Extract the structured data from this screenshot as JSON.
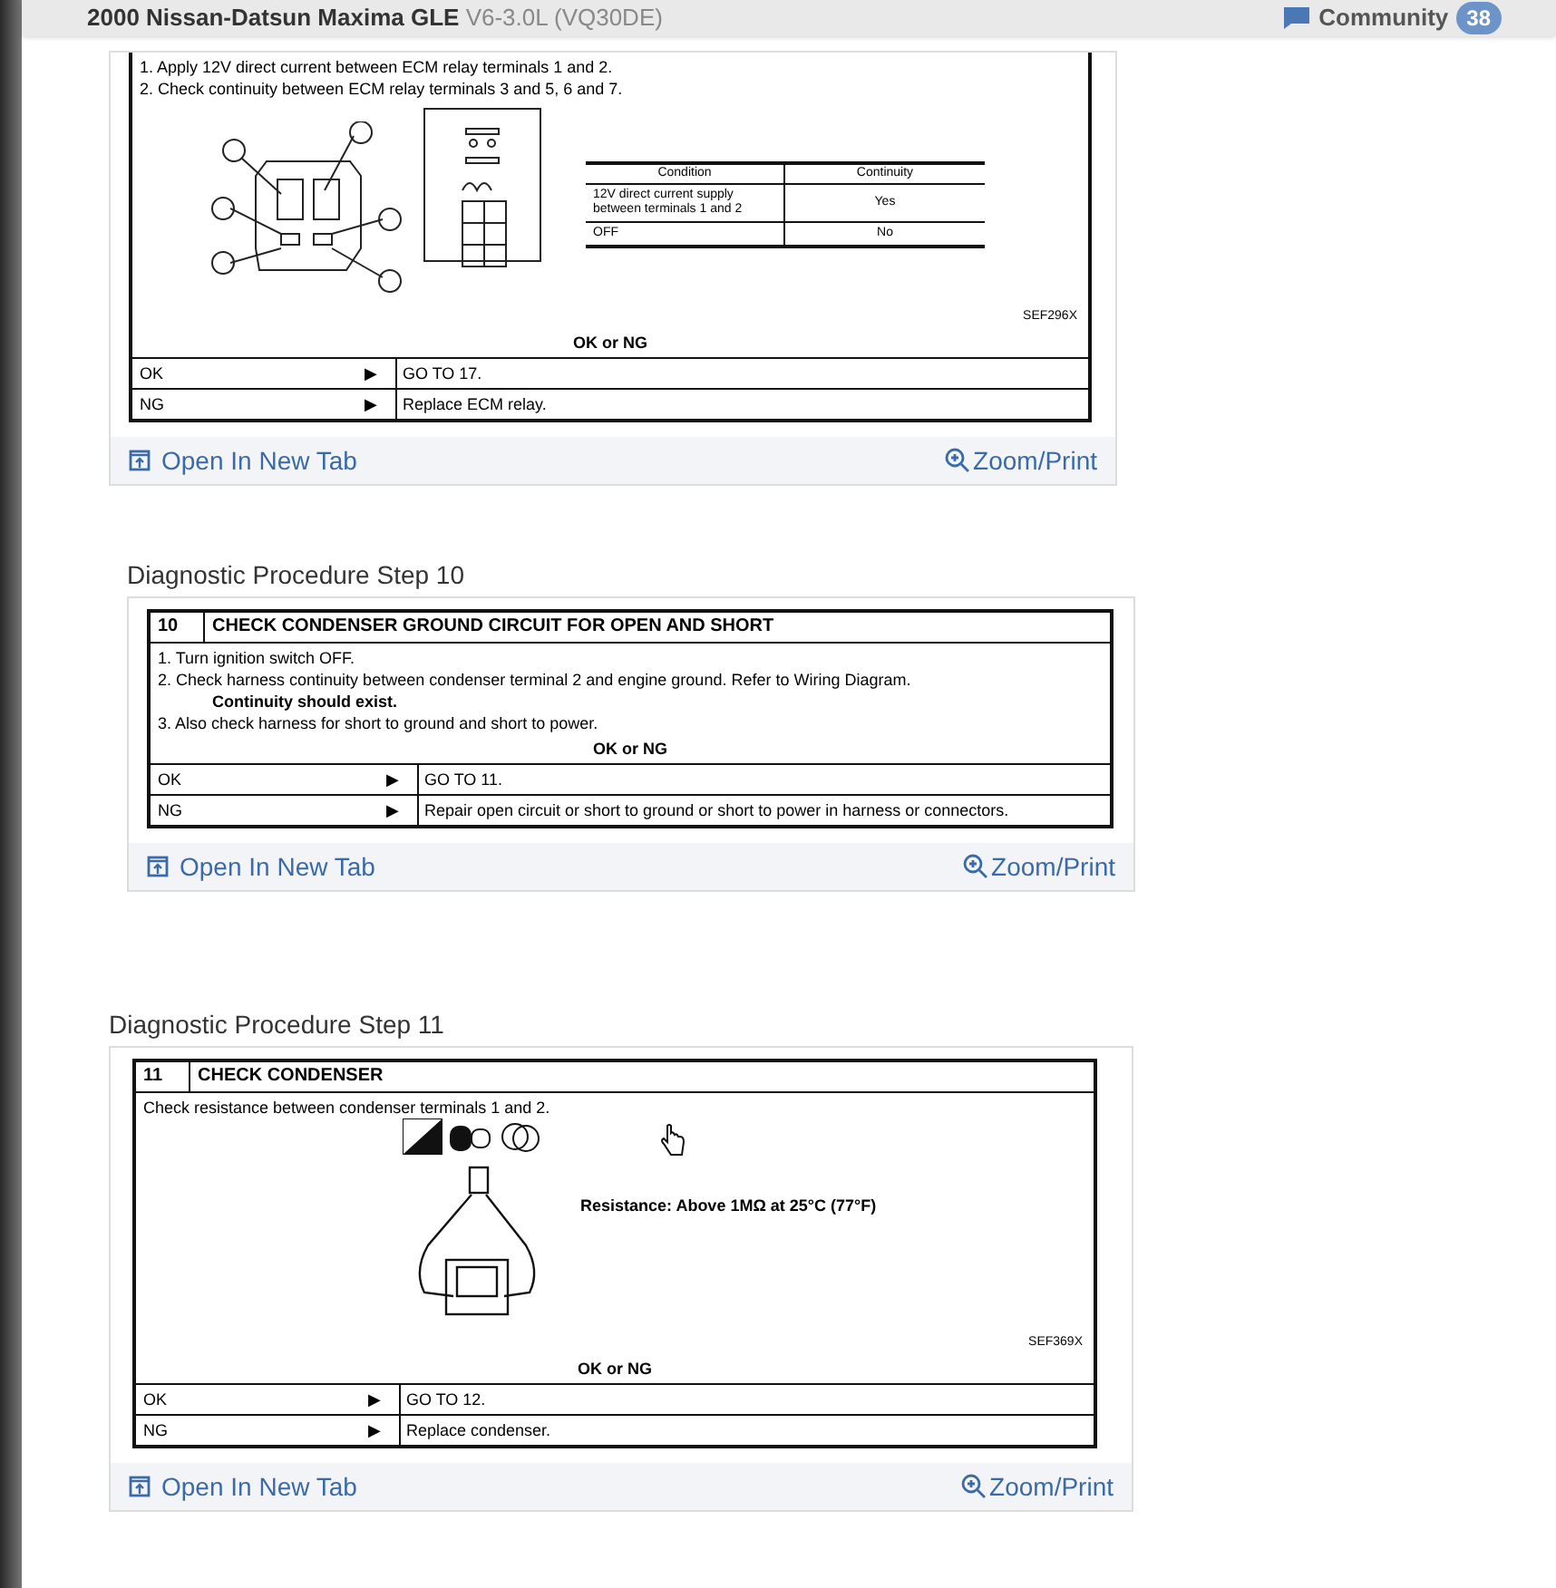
{
  "header": {
    "title": "2000 Nissan-Datsun Maxima GLE",
    "subtitle": "V6-3.0L (VQ30DE)",
    "community_label": "Community",
    "community_count": "38"
  },
  "cards": [
    {
      "kind": "relay",
      "instructions": [
        {
          "kind": "step",
          "text": "1.  Apply 12V direct current between ECM relay terminals 1 and 2."
        },
        {
          "kind": "step",
          "text": "2.  Check continuity between ECM relay terminals 3 and 5, 6 and 7."
        }
      ],
      "condition_table": {
        "columns": [
          "Condition",
          "Continuity"
        ],
        "rows": [
          [
            "12V direct current supply between terminals 1 and 2",
            "Yes"
          ],
          [
            "OFF",
            "No"
          ]
        ]
      },
      "figure_code": "SEF296X",
      "result_label": "OK or NG",
      "results": [
        {
          "label": "OK",
          "arrow": "▶",
          "action": "GO TO 17."
        },
        {
          "label": "NG",
          "arrow": "▶",
          "action": "Replace ECM relay."
        }
      ],
      "links": {
        "open": "Open In New Tab",
        "zoom": "Zoom/Print"
      }
    },
    {
      "heading": "Diagnostic Procedure Step 10",
      "step_number": "10",
      "step_title": "CHECK CONDENSER GROUND CIRCUIT FOR OPEN AND SHORT",
      "kind": "text",
      "instructions": [
        {
          "kind": "step",
          "text": "1.  Turn ignition switch OFF."
        },
        {
          "kind": "step",
          "text": "2.  Check harness continuity between condenser terminal 2 and engine ground. Refer to Wiring Diagram."
        },
        {
          "kind": "note",
          "text": "Continuity should exist."
        },
        {
          "kind": "step",
          "text": "3.  Also check harness for short to ground and short to power."
        }
      ],
      "result_label": "OK or NG",
      "results": [
        {
          "label": "OK",
          "arrow": "▶",
          "action": "GO TO 11."
        },
        {
          "label": "NG",
          "arrow": "▶",
          "action": "Repair open circuit or short to ground or short to power in harness or connectors."
        }
      ],
      "links": {
        "open": "Open In New Tab",
        "zoom": "Zoom/Print"
      }
    },
    {
      "heading": "Diagnostic Procedure Step 11",
      "step_number": "11",
      "step_title": "CHECK CONDENSER",
      "kind": "meter",
      "instructions": [
        {
          "kind": "step",
          "text": "Check resistance between condenser terminals 1 and 2."
        }
      ],
      "spec": "Resistance: Above 1MΩ at 25°C (77°F)",
      "figure_code": "SEF369X",
      "result_label": "OK or NG",
      "results": [
        {
          "label": "OK",
          "arrow": "▶",
          "action": "GO TO 12."
        },
        {
          "label": "NG",
          "arrow": "▶",
          "action": "Replace condenser."
        }
      ],
      "links": {
        "open": "Open In New Tab",
        "zoom": "Zoom/Print"
      }
    }
  ]
}
